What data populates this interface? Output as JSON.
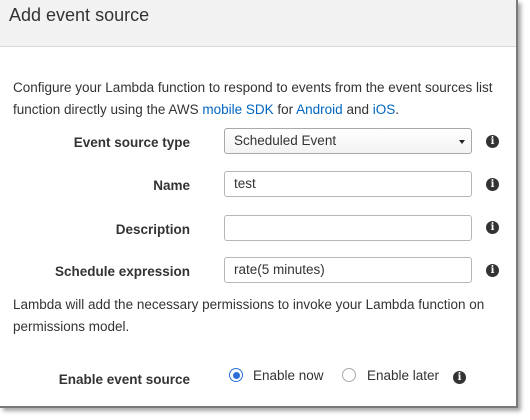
{
  "dialog": {
    "title": "Add event source",
    "intro_line1": "Configure your Lambda function to respond to events from the event sources list",
    "intro_line2_prefix": "function directly using the AWS ",
    "intro_link_sdk": "mobile SDK",
    "intro_for": " for ",
    "intro_link_android": "Android",
    "intro_and": " and ",
    "intro_link_ios": "iOS",
    "intro_period": "."
  },
  "form": {
    "event_source_type": {
      "label": "Event source type",
      "value": "Scheduled Event"
    },
    "name": {
      "label": "Name",
      "value": "test"
    },
    "description": {
      "label": "Description",
      "value": ""
    },
    "schedule_expression": {
      "label": "Schedule expression",
      "value": "rate(5 minutes)"
    }
  },
  "note": {
    "line1": "Lambda will add the necessary permissions to invoke your Lambda function on",
    "line2": "permissions model."
  },
  "enable": {
    "label": "Enable event source",
    "option_now": "Enable now",
    "option_later": "Enable later",
    "selected": "Enable now"
  },
  "icons": {
    "info": "info-icon",
    "dropdown": "chevron-down-icon"
  },
  "colors": {
    "link": "#0066c0",
    "radio_selected": "#2b6fd6",
    "header_bg": "#f2f2f2"
  }
}
